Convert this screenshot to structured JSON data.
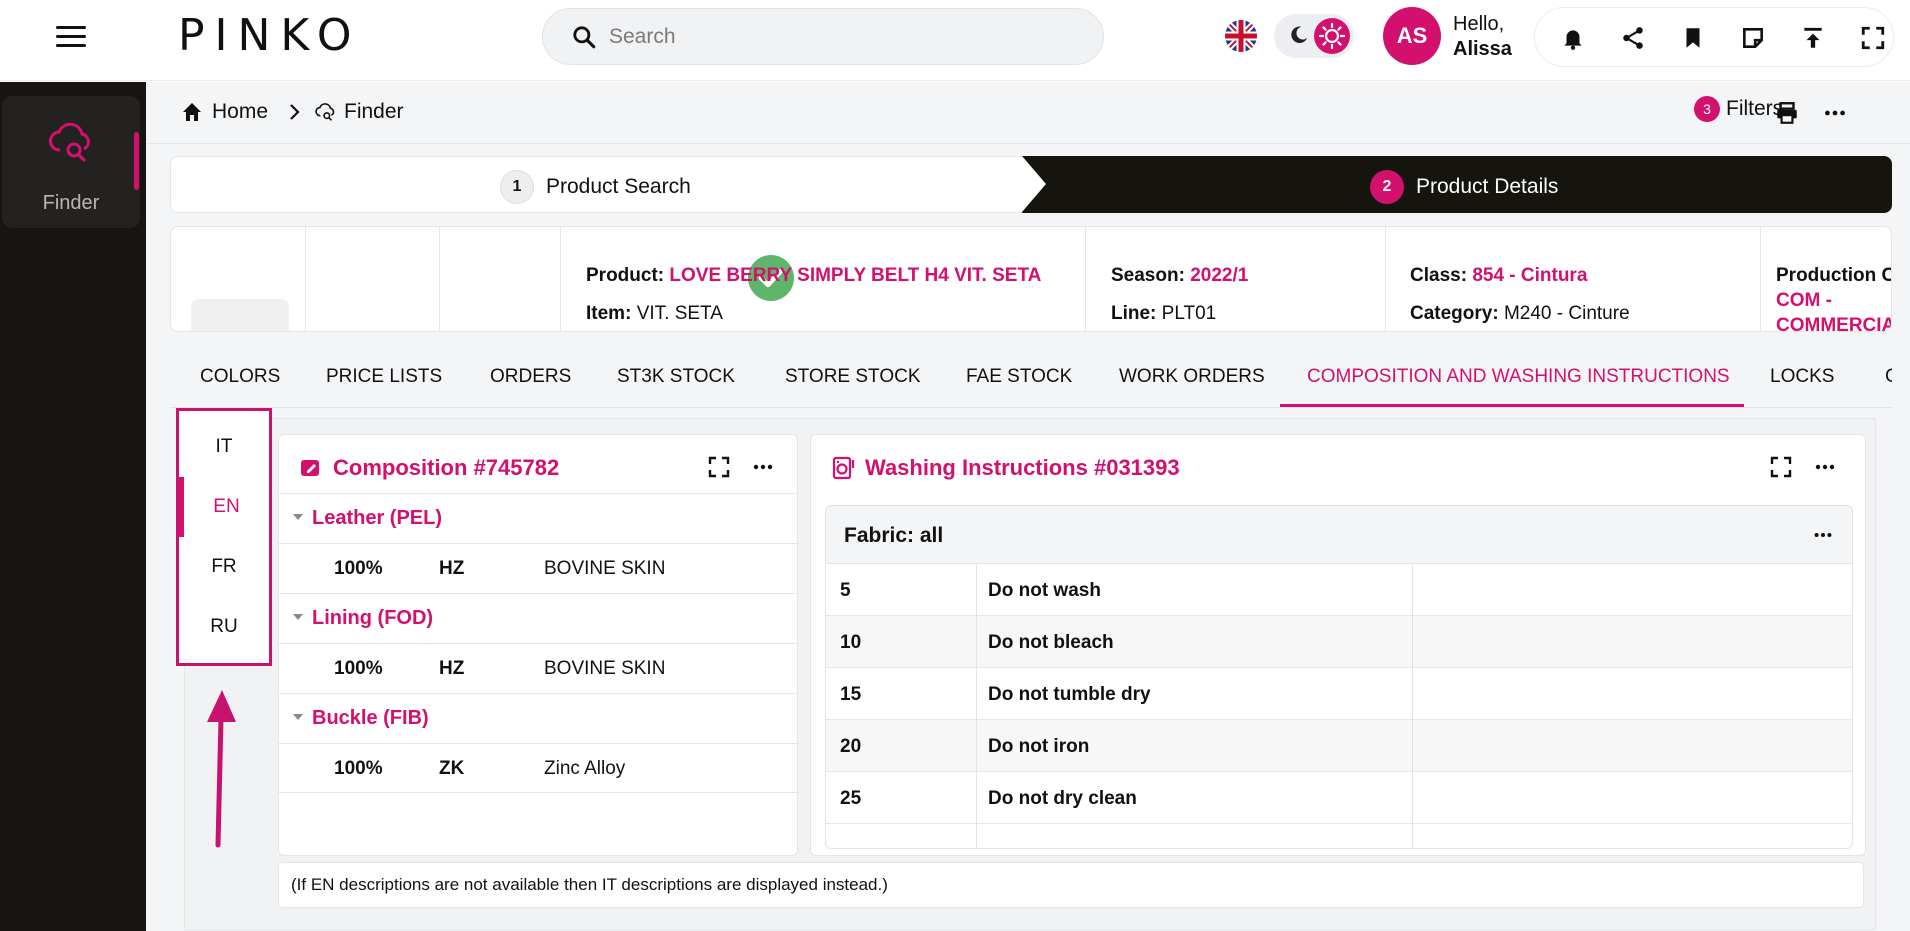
{
  "app": {
    "logo": "PINKO"
  },
  "search": {
    "placeholder": "Search"
  },
  "user": {
    "initials": "AS",
    "greeting": "Hello,",
    "name": "Alissa"
  },
  "rail": {
    "finder_label": "Finder"
  },
  "breadcrumb": {
    "home": "Home",
    "current": "Finder"
  },
  "toolbar": {
    "filters_count": "3",
    "filters_label": "Filters"
  },
  "stepper": {
    "step1": {
      "num": "1",
      "label": "Product Search"
    },
    "step2": {
      "num": "2",
      "label": "Product Details"
    }
  },
  "product": {
    "product_label": "Product:",
    "product_value": "LOVE BERRY SIMPLY BELT H4 VIT. SETA",
    "item_label": "Item:",
    "item_value": "VIT. SETA",
    "season_label": "Season:",
    "season_value": "2022/1",
    "line_label": "Line:",
    "line_value": "PLT01",
    "class_label": "Class:",
    "class_value": "854 - Cintura",
    "category_label": "Category:",
    "category_value": "M240 - Cinture",
    "production_label": "Production C",
    "production_value_1": "COM -",
    "production_value_2": "COMMERCIA"
  },
  "tabs": [
    {
      "label": "COLORS"
    },
    {
      "label": "PRICE LISTS"
    },
    {
      "label": "ORDERS"
    },
    {
      "label": "ST3K STOCK"
    },
    {
      "label": "STORE STOCK"
    },
    {
      "label": "FAE STOCK"
    },
    {
      "label": "WORK ORDERS"
    },
    {
      "label": "COMPOSITION AND WASHING INSTRUCTIONS"
    },
    {
      "label": "LOCKS"
    },
    {
      "label": "C"
    }
  ],
  "languages": [
    {
      "code": "IT"
    },
    {
      "code": "EN"
    },
    {
      "code": "FR"
    },
    {
      "code": "RU"
    }
  ],
  "composition": {
    "title": "Composition #745782",
    "groups": [
      {
        "name": "Leather (PEL)",
        "pct": "100%",
        "code": "HZ",
        "desc": "BOVINE SKIN"
      },
      {
        "name": "Lining (FOD)",
        "pct": "100%",
        "code": "HZ",
        "desc": "BOVINE SKIN"
      },
      {
        "name": "Buckle (FIB)",
        "pct": "100%",
        "code": "ZK",
        "desc": "Zinc Alloy"
      }
    ]
  },
  "washing": {
    "title": "Washing Instructions #031393",
    "fabric": "Fabric: all",
    "rows": [
      {
        "code": "5",
        "text": "Do not wash"
      },
      {
        "code": "10",
        "text": "Do not bleach"
      },
      {
        "code": "15",
        "text": "Do not tumble dry"
      },
      {
        "code": "20",
        "text": "Do not iron"
      },
      {
        "code": "25",
        "text": "Do not dry clean"
      }
    ]
  },
  "note": "(If EN descriptions are not available then IT descriptions are displayed instead.)",
  "colors": {
    "accent": "#d4106f",
    "rail": "#171411",
    "success": "#5fb66b"
  },
  "icons": [
    "menu-icon",
    "search-icon",
    "uk-flag-icon",
    "moon-icon",
    "sun-icon",
    "bell-icon",
    "share-icon",
    "bookmark-icon",
    "note-icon",
    "upload-icon",
    "fullscreen-icon",
    "cloud-search-icon",
    "home-icon",
    "chevron-right-icon",
    "print-icon",
    "more-icon",
    "check-icon",
    "edit-icon",
    "washing-machine-icon",
    "arrow-up-icon"
  ]
}
